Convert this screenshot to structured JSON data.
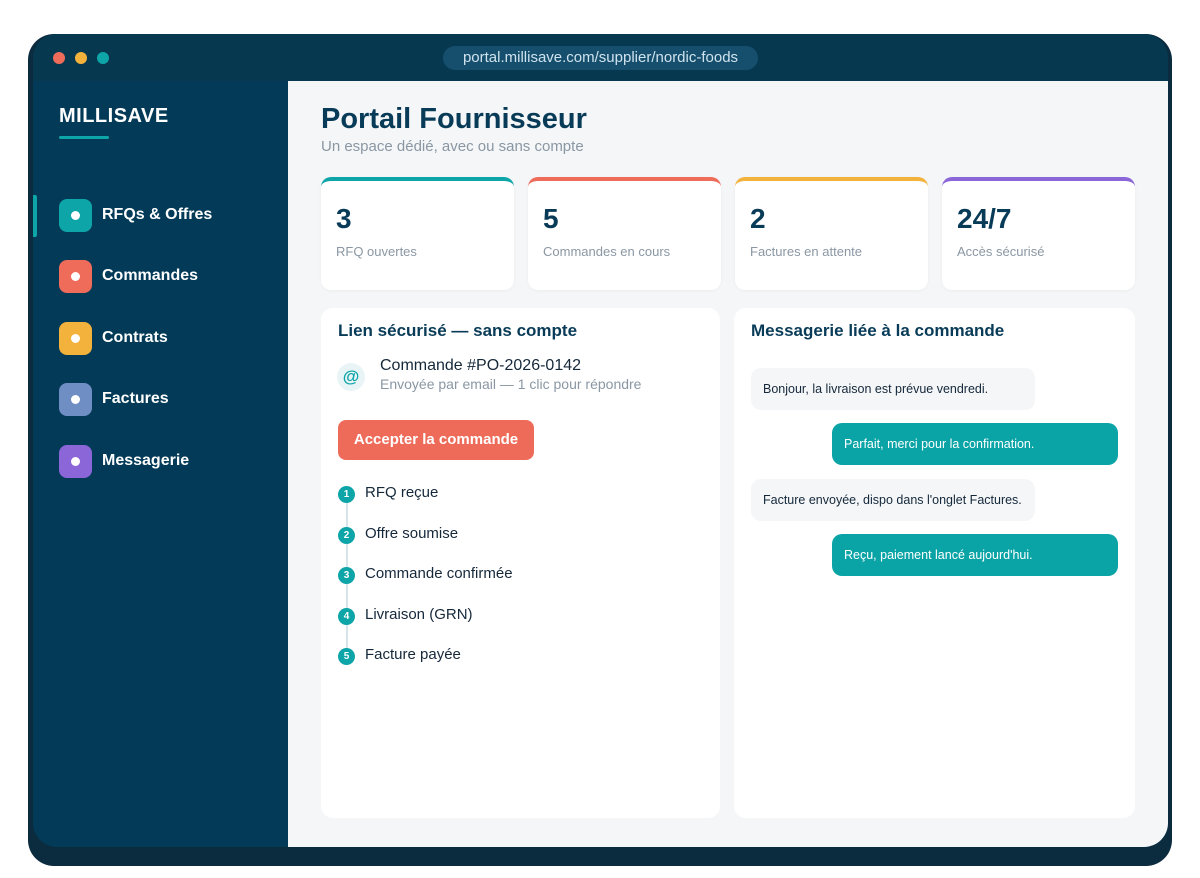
{
  "browser": {
    "url": "portal.millisave.com/supplier/nordic-foods",
    "dots": [
      "#ef6b5a",
      "#f3b23c",
      "#0ea5a8"
    ]
  },
  "sidebar": {
    "brand": "MILLISAVE",
    "items": [
      {
        "label": "RFQs & Offres",
        "color": "#0ea5a8",
        "active": true
      },
      {
        "label": "Commandes",
        "color": "#ef6b5a",
        "active": false
      },
      {
        "label": "Contrats",
        "color": "#f3b23c",
        "active": false
      },
      {
        "label": "Factures",
        "color": "#6f8fc4",
        "active": false
      },
      {
        "label": "Messagerie",
        "color": "#8a66d8",
        "active": false
      }
    ]
  },
  "header": {
    "title": "Portail Fournisseur",
    "subtitle": "Un espace dédié, avec ou sans compte"
  },
  "stats": [
    {
      "value": "3",
      "label": "RFQ ouvertes",
      "color": "#0ea5a8"
    },
    {
      "value": "5",
      "label": "Commandes en cours",
      "color": "#ef6b5a"
    },
    {
      "value": "2",
      "label": "Factures en attente",
      "color": "#f3b23c"
    },
    {
      "value": "24/7",
      "label": "Accès sécurisé",
      "color": "#8a66d8"
    }
  ],
  "secure_link": {
    "title": "Lien sécurisé — sans compte",
    "icon": "at-icon",
    "icon_glyph": "@",
    "order_title": "Commande #PO-2026-0142",
    "order_sub": "Envoyée par email — 1 clic pour répondre",
    "accept_label": "Accepter la commande",
    "steps": [
      {
        "num": "1",
        "label": "RFQ reçue"
      },
      {
        "num": "2",
        "label": "Offre soumise"
      },
      {
        "num": "3",
        "label": "Commande confirmée"
      },
      {
        "num": "4",
        "label": "Livraison (GRN)"
      },
      {
        "num": "5",
        "label": "Facture payée"
      }
    ]
  },
  "messaging": {
    "title": "Messagerie liée à la commande",
    "messages": [
      {
        "text": "Bonjour, la livraison est prévue vendredi.",
        "direction": "in"
      },
      {
        "text": "Parfait, merci pour la confirmation.",
        "direction": "out"
      },
      {
        "text": "Facture envoyée, dispo dans l'onglet Factures.",
        "direction": "in"
      },
      {
        "text": "Reçu, paiement lancé aujourd'hui.",
        "direction": "out"
      }
    ]
  }
}
